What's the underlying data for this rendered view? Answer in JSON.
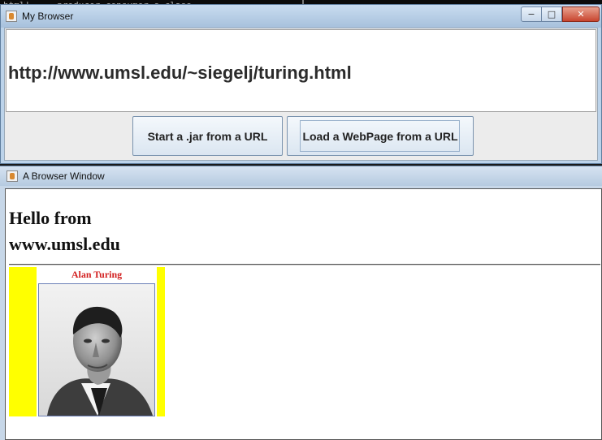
{
  "background": {
    "terminal_lines": [
      "html|     producer consumer s.class",
      "          producer consumer s.class"
    ]
  },
  "browser_window": {
    "title": "My Browser",
    "url": "http://www.umsl.edu/~siegelj/turing.html",
    "buttons": {
      "start_jar": "Start a .jar from a URL",
      "load_webpage": "Load a WebPage from a URL"
    },
    "controls": {
      "minimize": "−",
      "maximize": "□",
      "close": "✕"
    }
  },
  "page_window": {
    "title": "A Browser Window",
    "heading_line1": "Hello from",
    "heading_line2": "www.umsl.edu",
    "image_caption": "Alan Turing"
  },
  "colors": {
    "image_background": "#ffff00",
    "caption": "#d21e1e"
  }
}
